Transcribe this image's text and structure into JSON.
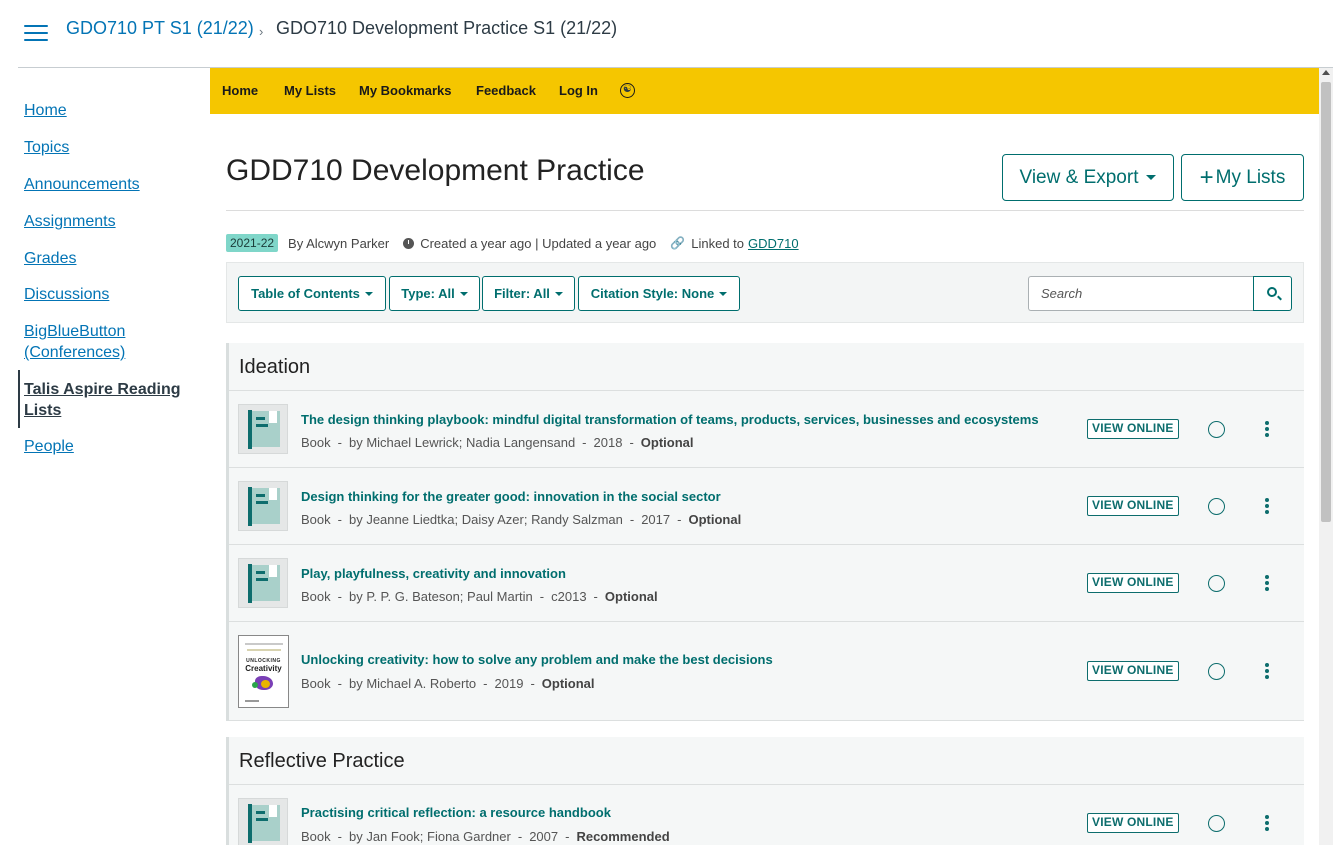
{
  "breadcrumb": {
    "course": "GDO710 PT S1 (21/22)",
    "separator": "›",
    "current": "GDO710 Development Practice S1 (21/22)"
  },
  "course_nav": [
    {
      "label": "Home"
    },
    {
      "label": "Topics"
    },
    {
      "label": "Announcements"
    },
    {
      "label": "Assignments"
    },
    {
      "label": "Grades"
    },
    {
      "label": "Discussions"
    },
    {
      "label": "BigBlueButton (Conferences)"
    },
    {
      "label": "Talis Aspire Reading Lists",
      "active": true
    },
    {
      "label": "People"
    }
  ],
  "talis_nav": {
    "home": "Home",
    "my_lists": "My Lists",
    "my_bookmarks": "My Bookmarks",
    "feedback": "Feedback",
    "log_in": "Log In",
    "accessibility_icon": "accessibility-icon",
    "bar_color": "#f5c600"
  },
  "list": {
    "title": "GDD710 Development Practice",
    "view_export_label": "View & Export",
    "my_lists_button": "My Lists",
    "year_badge": "2021-22",
    "author": "By Alcwyn Parker",
    "created_updated": "Created a year ago | Updated a year ago",
    "linked_to_label": "Linked to",
    "linked_to_link": "GDD710"
  },
  "toolbar": {
    "table_of_contents": "Table of Contents",
    "type": "Type: All",
    "filter": "Filter: All",
    "citation_style": "Citation Style: None",
    "search_placeholder": "Search"
  },
  "sections": [
    {
      "heading": "Ideation",
      "items": [
        {
          "title": "The design thinking playbook: mindful digital transformation of teams, products, services, businesses and ecosystems",
          "type": "Book",
          "authors": "by Michael Lewrick; Nadia Langensand",
          "year": "2018",
          "importance": "Optional",
          "action": "VIEW ONLINE"
        },
        {
          "title": "Design thinking for the greater good: innovation in the social sector",
          "type": "Book",
          "authors": "by Jeanne Liedtka; Daisy Azer; Randy Salzman",
          "year": "2017",
          "importance": "Optional",
          "action": "VIEW ONLINE"
        },
        {
          "title": "Play, playfulness, creativity and innovation",
          "type": "Book",
          "authors": "by P. P. G. Bateson; Paul Martin",
          "year": "c2013",
          "importance": "Optional",
          "action": "VIEW ONLINE"
        },
        {
          "title": "Unlocking creativity: how to solve any problem and make the best decisions",
          "type": "Book",
          "authors": "by Michael A. Roberto",
          "year": "2019",
          "importance": "Optional",
          "action": "VIEW ONLINE",
          "cover_text_1": "UNLOCKING",
          "cover_text_2": "Creativity"
        }
      ]
    },
    {
      "heading": "Reflective Practice",
      "items": [
        {
          "title": "Practising critical reflection: a resource handbook",
          "type": "Book",
          "authors": "by Jan Fook; Fiona Gardner",
          "year": "2007",
          "importance": "Recommended",
          "action": "VIEW ONLINE"
        }
      ]
    }
  ],
  "colors": {
    "canvas_link": "#0374b5",
    "talis_teal": "#006e6e",
    "badge": "#7fd6c9"
  }
}
